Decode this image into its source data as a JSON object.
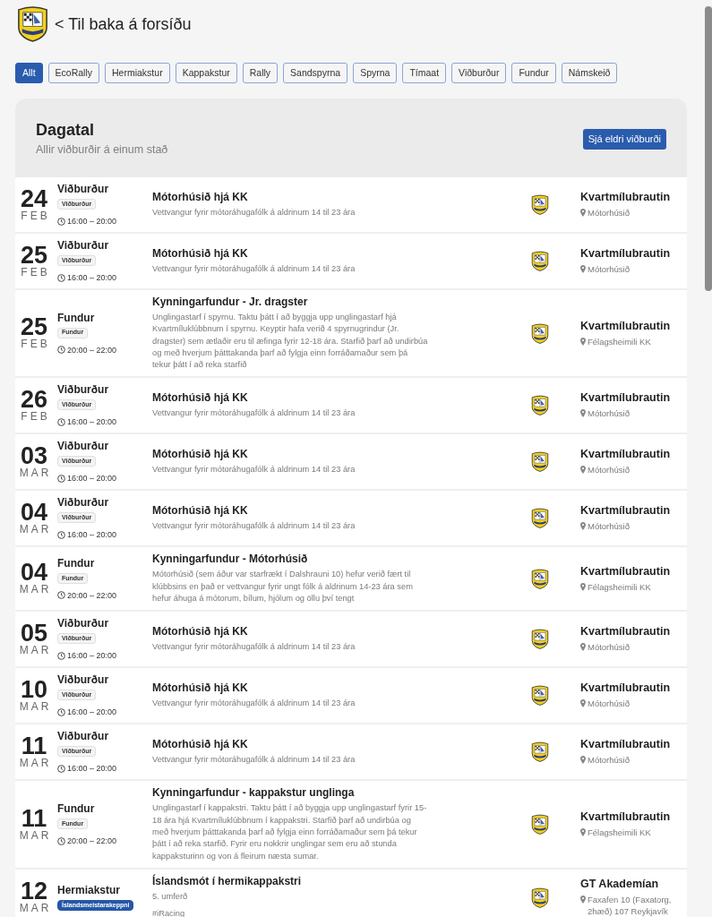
{
  "header": {
    "back_link": "< Til baka á forsíðu"
  },
  "filters": [
    {
      "label": "Allt",
      "selected": true
    },
    {
      "label": "EcoRally",
      "selected": false
    },
    {
      "label": "Hermiakstur",
      "selected": false
    },
    {
      "label": "Kappakstur",
      "selected": false
    },
    {
      "label": "Rally",
      "selected": false
    },
    {
      "label": "Sandspyrna",
      "selected": false
    },
    {
      "label": "Spyrna",
      "selected": false
    },
    {
      "label": "Tímaat",
      "selected": false
    },
    {
      "label": "Viðburður",
      "selected": false
    },
    {
      "label": "Fundur",
      "selected": false
    },
    {
      "label": "Námskeið",
      "selected": false
    }
  ],
  "calendar": {
    "title": "Dagatal",
    "subtitle": "Allir viðburðir á einum stað",
    "older_button": "Sjá eldri viðburði",
    "events": [
      {
        "day": "24",
        "month": "FEB",
        "category": "Viðburður",
        "badge": {
          "text": "Viðburður",
          "kind": "plain"
        },
        "time": "16:00 – 20:00",
        "title": "Mótorhúsið hjá KK",
        "description": "Vettvangur fyrir mótoráhugafólk á aldrinum 14 til 23 ára",
        "venue": "Kvartmílubrautin",
        "place": "Mótorhúsið"
      },
      {
        "day": "25",
        "month": "FEB",
        "category": "Viðburður",
        "badge": {
          "text": "Viðburður",
          "kind": "plain"
        },
        "time": "16:00 – 20:00",
        "title": "Mótorhúsið hjá KK",
        "description": "Vettvangur fyrir mótoráhugafólk á aldrinum 14 til 23 ára",
        "venue": "Kvartmílubrautin",
        "place": "Mótorhúsið"
      },
      {
        "day": "25",
        "month": "FEB",
        "category": "Fundur",
        "badge": {
          "text": "Fundur",
          "kind": "plain"
        },
        "time": "20:00 – 22:00",
        "title": "Kynningarfundur - Jr. dragster",
        "description": "Unglingastarf í spyrnu. Taktu þátt í að byggja upp unglingastarf hjá Kvartmíluklúbbnum í spyrnu. Keyptir hafa verið 4 spyrnugrindur (Jr. dragster) sem ætlaðir eru til æfinga fyrir 12-18 ára. Starfið þarf að undirbúa og með hverjum þátttakanda þarf að fylgja einn forráðamaður sem þá tekur þátt í að reka starfið",
        "venue": "Kvartmílubrautin",
        "place": "Félagsheimili KK"
      },
      {
        "day": "26",
        "month": "FEB",
        "category": "Viðburður",
        "badge": {
          "text": "Viðburður",
          "kind": "plain"
        },
        "time": "16:00 – 20:00",
        "title": "Mótorhúsið hjá KK",
        "description": "Vettvangur fyrir mótoráhugafólk á aldrinum 14 til 23 ára",
        "venue": "Kvartmílubrautin",
        "place": "Mótorhúsið"
      },
      {
        "day": "03",
        "month": "MAR",
        "category": "Viðburður",
        "badge": {
          "text": "Viðburður",
          "kind": "plain"
        },
        "time": "16:00 – 20:00",
        "title": "Mótorhúsið hjá KK",
        "description": "Vettvangur fyrir mótoráhugafólk á aldrinum 14 til 23 ára",
        "venue": "Kvartmílubrautin",
        "place": "Mótorhúsið"
      },
      {
        "day": "04",
        "month": "MAR",
        "category": "Viðburður",
        "badge": {
          "text": "Viðburður",
          "kind": "plain"
        },
        "time": "16:00 – 20:00",
        "title": "Mótorhúsið hjá KK",
        "description": "Vettvangur fyrir mótoráhugafólk á aldrinum 14 til 23 ára",
        "venue": "Kvartmílubrautin",
        "place": "Mótorhúsið"
      },
      {
        "day": "04",
        "month": "MAR",
        "category": "Fundur",
        "badge": {
          "text": "Fundur",
          "kind": "plain"
        },
        "time": "20:00 – 22:00",
        "title": "Kynningarfundur - Mótorhúsið",
        "description": "Mótorhúsið (sem áður var starfrækt í Dalshrauni 10) hefur verið fært til klúbbsins en það er vettvangur fyrir ungt fólk á aldrinum 14-23 ára sem hefur áhuga á mótorum, bílum, hjólum og öllu því tengt",
        "venue": "Kvartmílubrautin",
        "place": "Félagsheimili KK"
      },
      {
        "day": "05",
        "month": "MAR",
        "category": "Viðburður",
        "badge": {
          "text": "Viðburður",
          "kind": "plain"
        },
        "time": "16:00 – 20:00",
        "title": "Mótorhúsið hjá KK",
        "description": "Vettvangur fyrir mótoráhugafólk á aldrinum 14 til 23 ára",
        "venue": "Kvartmílubrautin",
        "place": "Mótorhúsið"
      },
      {
        "day": "10",
        "month": "MAR",
        "category": "Viðburður",
        "badge": {
          "text": "Viðburður",
          "kind": "plain"
        },
        "time": "16:00 – 20:00",
        "title": "Mótorhúsið hjá KK",
        "description": "Vettvangur fyrir mótoráhugafólk á aldrinum 14 til 23 ára",
        "venue": "Kvartmílubrautin",
        "place": "Mótorhúsið"
      },
      {
        "day": "11",
        "month": "MAR",
        "category": "Viðburður",
        "badge": {
          "text": "Viðburður",
          "kind": "plain"
        },
        "time": "16:00 – 20:00",
        "title": "Mótorhúsið hjá KK",
        "description": "Vettvangur fyrir mótoráhugafólk á aldrinum 14 til 23 ára",
        "venue": "Kvartmílubrautin",
        "place": "Mótorhúsið"
      },
      {
        "day": "11",
        "month": "MAR",
        "category": "Fundur",
        "badge": {
          "text": "Fundur",
          "kind": "plain"
        },
        "time": "20:00 – 22:00",
        "title": "Kynningarfundur - kappakstur unglinga",
        "description": "Unglingastarf í kappakstri. Taktu þátt í að byggja upp unglingastarf fyrir 15-18 ára hjá Kvartmíluklúbbnum í kappakstri. Starfið þarf að undirbúa og með hverjum þátttakanda þarf að fylgja einn forráðamaður sem þá tekur þátt í að reka starfið. Fyrir eru nokkrir unglingar sem eru að stunda kappaksturinn og von á fleirum næsta sumar.",
        "venue": "Kvartmílubrautin",
        "place": "Félagsheimili KK"
      },
      {
        "day": "12",
        "month": "MAR",
        "category": "Hermiakstur",
        "badge": {
          "text": "Íslandsmeistarakeppni",
          "kind": "highlight"
        },
        "title": "Íslandsmót í hermikappakstri",
        "description": "5. umferð",
        "hashtag": "#iRacing",
        "venue": "GT Akademían",
        "place": "Faxafen 10 (Faxatorg, 2hæð) 107 Reykjavík"
      }
    ]
  }
}
